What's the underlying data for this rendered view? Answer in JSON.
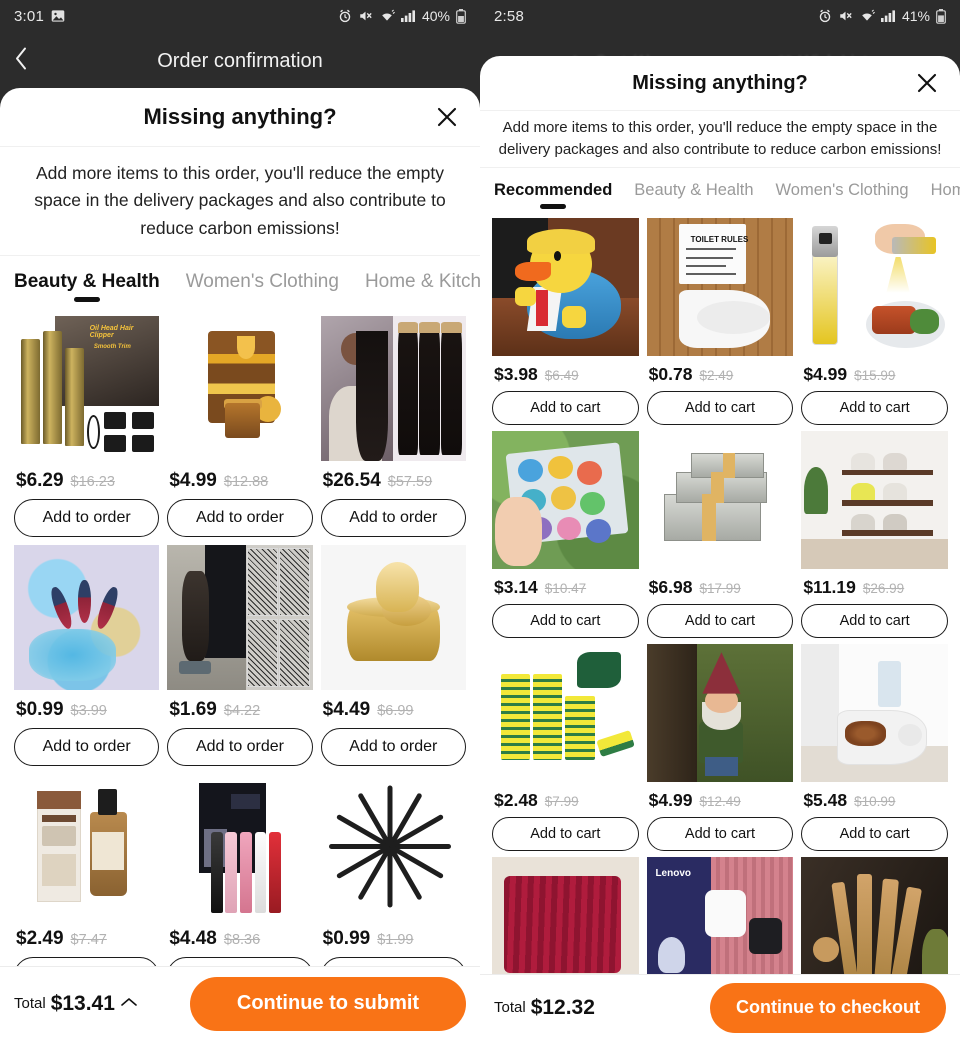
{
  "left": {
    "status": {
      "time": "3:01",
      "battery": "40%",
      "icons": [
        "image-icon",
        "alarm-icon",
        "mute-icon",
        "wifi-icon",
        "signal-icon",
        "battery-icon"
      ]
    },
    "app_header": {
      "title": "Order confirmation",
      "back_label": "‹"
    },
    "sheet": {
      "title": "Missing anything?",
      "close_label": "✕",
      "description": "Add more items to this order, you'll reduce the empty space in the delivery packages and also contribute to reduce carbon emissions!"
    },
    "tabs": [
      {
        "label": "Beauty & Health",
        "active": true
      },
      {
        "label": "Women's Clothing",
        "active": false
      },
      {
        "label": "Home & Kitche",
        "active": false
      }
    ],
    "add_button_label": "Add to order",
    "products": [
      {
        "name": "oil-head-hair-clipper",
        "price": "$6.29",
        "original": "$16.23",
        "art": "a-clipper"
      },
      {
        "name": "honey-repair-hair-mask",
        "price": "$4.99",
        "original": "$12.88",
        "art": "a-honey"
      },
      {
        "name": "straight-hair-bundles",
        "price": "$26.54",
        "original": "$57.59",
        "art": "a-hair"
      },
      {
        "name": "glitter-nail-art",
        "price": "$0.99",
        "original": "$3.99",
        "art": "a-nails"
      },
      {
        "name": "temporary-tattoo-sleeve",
        "price": "$1.69",
        "original": "$4.22",
        "art": "a-tattoo"
      },
      {
        "name": "gold-eye-mask-patches",
        "price": "$4.49",
        "original": "$6.99",
        "art": "a-gold"
      },
      {
        "name": "dark-circle-eye-serum",
        "price": "$2.49",
        "original": "$7.47",
        "art": "a-serum"
      },
      {
        "name": "lipstick-facial-shaver",
        "price": "$4.48",
        "original": "$8.36",
        "art": "a-shaver"
      },
      {
        "name": "black-hair-clips",
        "price": "$0.99",
        "original": "$1.99",
        "art": "a-clips"
      }
    ],
    "bottom": {
      "total_label": "Total",
      "total_amount": "$13.41",
      "chevron": "⌃",
      "cta": "Continue to submit"
    }
  },
  "right": {
    "status": {
      "time": "2:58",
      "battery": "41%",
      "icons": [
        "alarm-icon",
        "mute-icon",
        "wifi-icon",
        "signal-icon",
        "battery-icon"
      ]
    },
    "ghost_tabs": [
      {
        "label": "Cart (1)"
      },
      {
        "label": "Wish List"
      }
    ],
    "sheet": {
      "title": "Missing anything?",
      "close_label": "✕",
      "description": "Add more items to this order, you'll reduce the empty space in the delivery packages and also contribute to reduce carbon emissions!"
    },
    "tabs": [
      {
        "label": "Recommended",
        "active": true
      },
      {
        "label": "Beauty & Health",
        "active": false
      },
      {
        "label": "Women's Clothing",
        "active": false
      },
      {
        "label": "Home",
        "active": false
      }
    ],
    "add_button_label": "Add to cart",
    "products": [
      {
        "name": "trump-rubber-duck",
        "price": "$3.98",
        "original": "$6.49",
        "art": "a-duck"
      },
      {
        "name": "toilet-rules-decal",
        "price": "$0.78",
        "original": "$2.49",
        "art": "a-toilet"
      },
      {
        "name": "olive-oil-sprayer",
        "price": "$4.99",
        "original": "$15.99",
        "art": "a-oil"
      },
      {
        "name": "mini-petroleum-jelly-set",
        "price": "$3.14",
        "original": "$10.47",
        "art": "a-vas"
      },
      {
        "name": "prop-money-stack",
        "price": "$6.98",
        "original": "$17.99",
        "art": "a-money"
      },
      {
        "name": "stackable-shoe-rack",
        "price": "$11.19",
        "original": "$26.99",
        "art": "a-rack"
      },
      {
        "name": "scrub-sponge-pack",
        "price": "$2.48",
        "original": "$7.99",
        "art": "a-sponge"
      },
      {
        "name": "garden-gnome-statue",
        "price": "$4.99",
        "original": "$12.49",
        "art": "a-gnome"
      },
      {
        "name": "corner-pet-feeder",
        "price": "$5.48",
        "original": "$10.99",
        "art": "a-feeder"
      },
      {
        "name": "knitted-throw-blanket",
        "price": "",
        "original": "",
        "art": "a-blanket"
      },
      {
        "name": "lenovo-wireless-earbuds",
        "price": "",
        "original": "",
        "art": "a-lenovo"
      },
      {
        "name": "wooden-kitchen-utensils",
        "price": "",
        "original": "",
        "art": "a-wood"
      }
    ],
    "bottom": {
      "total_label": "Total",
      "total_amount": "$12.32",
      "cta": "Continue to checkout"
    }
  },
  "colors": {
    "accent": "#f97316",
    "text": "#111111",
    "muted": "#9a9a9a",
    "strike": "#b2b2b2",
    "dark_bg": "#2c2c2c"
  }
}
